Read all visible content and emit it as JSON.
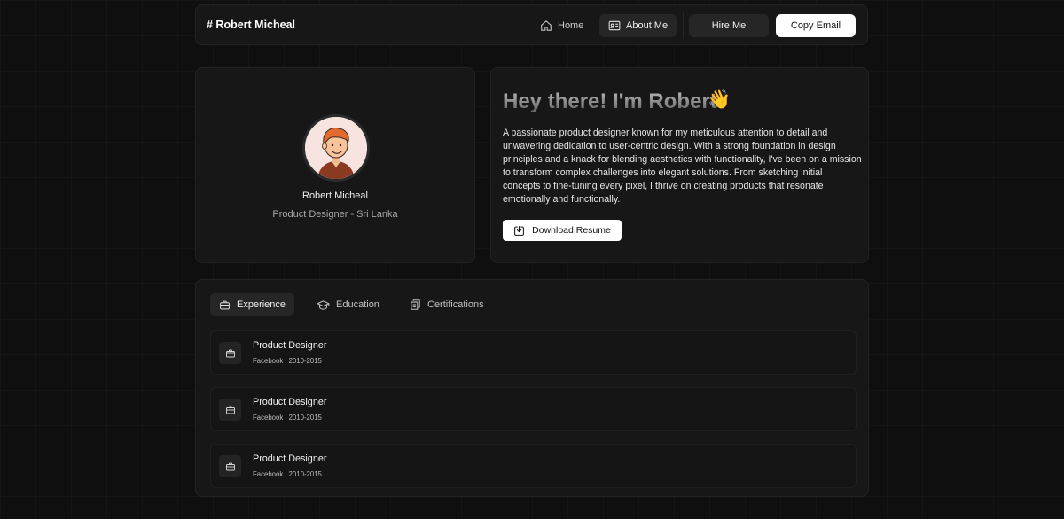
{
  "nav": {
    "brand": "# Robert Micheal",
    "links": [
      {
        "label": "Home",
        "icon": "home-icon"
      },
      {
        "label": "About Me",
        "icon": "id-card-icon"
      }
    ],
    "hire_label": "Hire Me",
    "copy_email_label": "Copy Email"
  },
  "profile": {
    "name": "Robert Micheal",
    "role": "Product Designer - Sri Lanka",
    "avatar": "avatar-illustration"
  },
  "intro": {
    "title": "Hey there! I'm Robert",
    "emoji": "👋",
    "bio": "A passionate product designer known for my meticulous attention to detail and unwavering dedication to user-centric design. With a strong foundation in design principles and a knack for blending aesthetics with functionality, I've been on a mission to transform complex challenges into elegant solutions. From sketching initial concepts to fine-tuning every pixel, I thrive on creating products that resonate emotionally and functionally.",
    "resume_label": "Download Resume"
  },
  "tabs": [
    {
      "label": "Experience",
      "icon": "briefcase-icon",
      "active": true
    },
    {
      "label": "Education",
      "icon": "graduation-cap-icon",
      "active": false
    },
    {
      "label": "Certifications",
      "icon": "documents-icon",
      "active": false
    }
  ],
  "experience": [
    {
      "title": "Product Designer",
      "subtitle": "Facebook | 2010-2015"
    },
    {
      "title": "Product Designer",
      "subtitle": "Facebook | 2010-2015"
    },
    {
      "title": "Product Designer",
      "subtitle": "Facebook | 2010-2015"
    }
  ],
  "colors": {
    "background": "#0f0f0f",
    "card": "#171717",
    "accent_button": "#ffffff",
    "muted_button": "#262626"
  }
}
